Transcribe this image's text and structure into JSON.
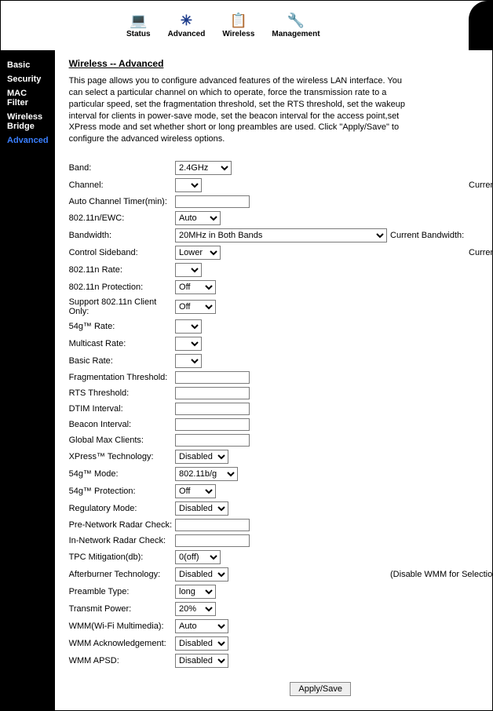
{
  "topnav": {
    "items": [
      {
        "label": "Status",
        "icon": "💻"
      },
      {
        "label": "Advanced",
        "icon": "✳"
      },
      {
        "label": "Wireless",
        "icon": "📋"
      },
      {
        "label": "Management",
        "icon": "🔧"
      }
    ]
  },
  "sidebar": {
    "items": [
      {
        "label": "Basic"
      },
      {
        "label": "Security"
      },
      {
        "label": "MAC Filter"
      },
      {
        "label": "Wireless Bridge"
      },
      {
        "label": "Advanced",
        "active": true
      }
    ]
  },
  "page": {
    "title": "Wireless -- Advanced",
    "description": "This page allows you to configure advanced features of the wireless LAN interface. You can select a particular channel on which to operate, force the transmission rate to a particular speed, set the fragmentation threshold, set the RTS threshold, set the wakeup interval for clients in power-save mode, set the beacon interval for the access point,set XPress mode and set whether short or long preambles are used. Click \"Apply/Save\" to configure the advanced wireless options."
  },
  "form": {
    "band": {
      "label": "Band:",
      "value": "2.4GHz"
    },
    "channel": {
      "label": "Channel:",
      "value": "",
      "extra": "Current Channel:"
    },
    "auto_channel_timer": {
      "label": "Auto Channel Timer(min):",
      "value": ""
    },
    "n_ewc": {
      "label": "802.11n/EWC:",
      "value": "Auto"
    },
    "bandwidth": {
      "label": "Bandwidth:",
      "value": "20MHz in Both Bands",
      "extra": "Current Bandwidth:"
    },
    "control_sideband": {
      "label": "Control Sideband:",
      "value": "Lower",
      "extra": "Current Control Sideband:"
    },
    "rate_11n": {
      "label": "802.11n Rate:",
      "value": ""
    },
    "protection_11n": {
      "label": "802.11n Protection:",
      "value": "Off"
    },
    "client_only_11n": {
      "label": "Support 802.11n Client Only:",
      "value": "Off"
    },
    "rate_54g": {
      "label": "54g™ Rate:",
      "value": ""
    },
    "multicast_rate": {
      "label": "Multicast Rate:",
      "value": ""
    },
    "basic_rate": {
      "label": "Basic Rate:",
      "value": ""
    },
    "frag_threshold": {
      "label": "Fragmentation Threshold:",
      "value": ""
    },
    "rts_threshold": {
      "label": "RTS Threshold:",
      "value": ""
    },
    "dtim_interval": {
      "label": "DTIM Interval:",
      "value": ""
    },
    "beacon_interval": {
      "label": "Beacon Interval:",
      "value": ""
    },
    "global_max_clients": {
      "label": "Global Max Clients:",
      "value": ""
    },
    "xpress": {
      "label": "XPress™ Technology:",
      "value": "Disabled"
    },
    "mode_54g": {
      "label": "54g™ Mode:",
      "value": "802.11b/g"
    },
    "protection_54g": {
      "label": "54g™ Protection:",
      "value": "Off"
    },
    "regulatory_mode": {
      "label": "Regulatory Mode:",
      "value": "Disabled"
    },
    "pre_radar": {
      "label": "Pre-Network Radar Check:",
      "value": ""
    },
    "in_radar": {
      "label": "In-Network Radar Check:",
      "value": ""
    },
    "tpc": {
      "label": "TPC Mitigation(db):",
      "value": "0(off)"
    },
    "afterburner": {
      "label": "Afterburner Technology:",
      "value": "Disabled",
      "extra": "(Disable WMM for Selection)"
    },
    "preamble": {
      "label": "Preamble Type:",
      "value": "long"
    },
    "tx_power": {
      "label": "Transmit Power:",
      "value": "20%"
    },
    "wmm": {
      "label": "WMM(Wi-Fi Multimedia):",
      "value": "Auto"
    },
    "wmm_ack": {
      "label": "WMM Acknowledgement:",
      "value": "Disabled"
    },
    "wmm_apsd": {
      "label": "WMM APSD:",
      "value": "Disabled"
    }
  },
  "buttons": {
    "apply": "Apply/Save"
  }
}
